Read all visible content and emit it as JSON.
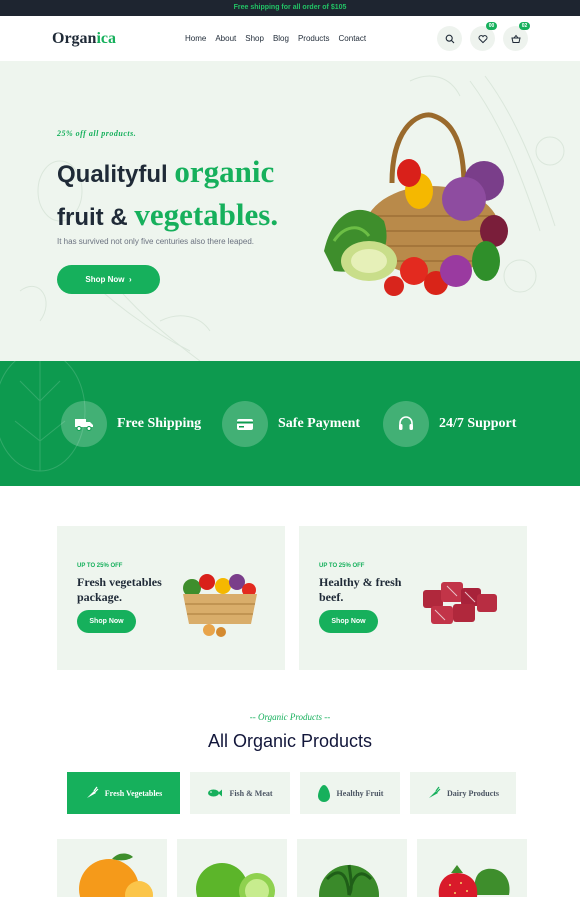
{
  "topbar": {
    "text": "Free shipping for all order of $105"
  },
  "header": {
    "logo_part1": "Organ",
    "logo_part2": "ica",
    "nav": [
      "Home",
      "About",
      "Shop",
      "Blog",
      "Products",
      "Contact"
    ],
    "wishlist_count": "00",
    "cart_count": "02"
  },
  "hero": {
    "promo": "25% off all products.",
    "title_line1_a": "Qualityful ",
    "title_line1_b": "organic",
    "title_line2_a": "fruit & ",
    "title_line2_b": "vegetables.",
    "subtitle": "It has survived not only five centuries also there leaped.",
    "button_label": "Shop Now",
    "button_arrow": "›"
  },
  "features": [
    {
      "label": "Free Shipping",
      "icon": "truck-icon"
    },
    {
      "label": "Safe Payment",
      "icon": "card-icon"
    },
    {
      "label": "24/7 Support",
      "icon": "headset-icon"
    }
  ],
  "cards": [
    {
      "tag": "UP TO 25% OFF",
      "title": "Fresh vegetables package.",
      "button": "Shop Now",
      "image": "vegetable-crate"
    },
    {
      "tag": "UP TO 25% OFF",
      "title": "Healthy & fresh beef.",
      "button": "Shop Now",
      "image": "beef-cubes"
    }
  ],
  "section": {
    "subtitle": "-- Organic Products --",
    "title": "All Organic Products"
  },
  "tabs": [
    {
      "label": "Fresh Vegetables",
      "icon": "carrot-icon",
      "active": true
    },
    {
      "label": "Fish & Meat",
      "icon": "fish-icon",
      "active": false
    },
    {
      "label": "Healthy Fruit",
      "icon": "avocado-icon",
      "active": false
    },
    {
      "label": "Dairy Products",
      "icon": "carrot-icon",
      "active": false
    }
  ],
  "products": [
    "orange",
    "lime",
    "watermelon",
    "strawberry"
  ],
  "colors": {
    "accent": "#16b05c",
    "dark": "#1e2530",
    "feature_band": "#0d9a4f",
    "pale": "#eef5ee"
  }
}
